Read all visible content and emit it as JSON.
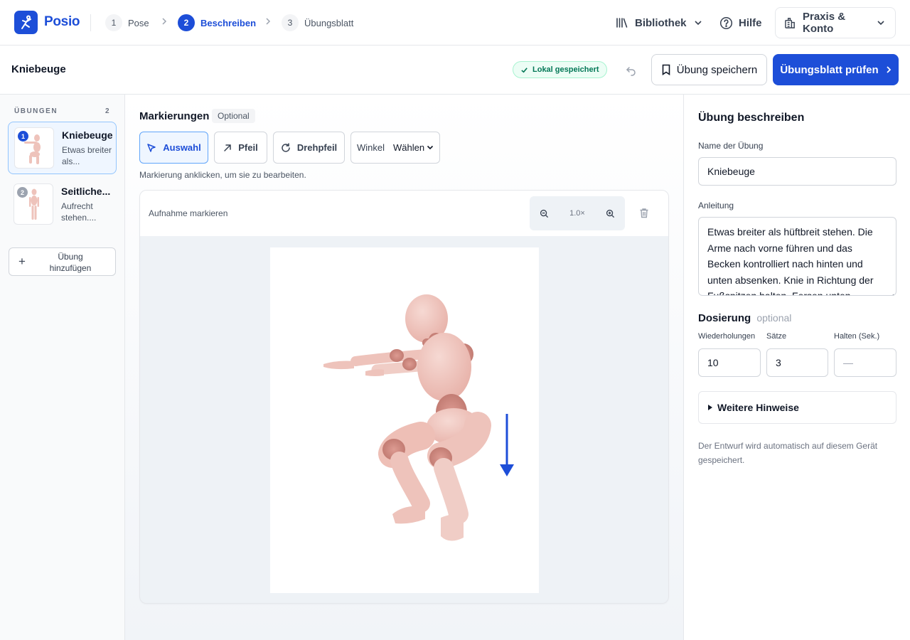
{
  "app": {
    "brand": "Posio",
    "colors": {
      "accent": "#1d4ed8",
      "success": "#047857",
      "figure": "#eec3bb"
    }
  },
  "steps": [
    {
      "num": "1",
      "label": "Pose",
      "state": "done"
    },
    {
      "num": "2",
      "label": "Beschreiben",
      "state": "active"
    },
    {
      "num": "3",
      "label": "Übungsblatt",
      "state": "todo"
    }
  ],
  "topnav": {
    "library_label": "Bibliothek",
    "library_icon": "library-icon",
    "help_label": "Hilfe",
    "help_icon": "question-circle-icon",
    "account_label": "Praxis & Konto",
    "account_icon": "building-icon"
  },
  "header": {
    "page_title": "Kniebeuge",
    "saved_badge": "Lokal gespeichert",
    "save_button": "Übung speichern",
    "primary_button": "Übungsblatt prüfen"
  },
  "sidebar": {
    "heading": "ÜBUNGEN",
    "count": "2",
    "exercises": [
      {
        "index": "1",
        "title": "Kniebeuge",
        "desc": "Etwas breiter als...",
        "active": true
      },
      {
        "index": "2",
        "title": "Seitliche...",
        "desc": "Aufrecht stehen....",
        "active": false
      }
    ],
    "add_button": "Übung hinzufügen"
  },
  "markup": {
    "title": "Markierungen",
    "optional_tag": "Optional",
    "tools": [
      {
        "label": "Auswahl",
        "icon": "cursor-icon",
        "active": true
      },
      {
        "label": "Pfeil",
        "icon": "arrow-up-right-icon",
        "active": false
      },
      {
        "label": "Drehpfeil",
        "icon": "rotate-icon",
        "active": false
      }
    ],
    "angle_label": "Winkel",
    "angle_select": "Wählen",
    "hint": "Markierung anklicken, um sie zu bearbeiten.",
    "canvas_label": "Aufnahme markieren",
    "zoom_level": "1.0×"
  },
  "form": {
    "title": "Übung beschreiben",
    "name_label": "Name der Übung",
    "name_value": "Kniebeuge",
    "instructions_label": "Anleitung",
    "instructions_value": "Etwas breiter als hüftbreit stehen. Die Arme nach vorne führen und das Becken kontrolliert nach hinten und unten absenken. Knie in Richtung der Fußspitzen halten. Fersen unten",
    "dosage_title": "Dosierung",
    "dosage_optional": "optional",
    "reps_label": "Wiederholungen",
    "reps_value": "10",
    "sets_label": "Sätze",
    "sets_value": "3",
    "hold_label": "Halten (Sek.)",
    "hold_placeholder": "—",
    "details_label": "Weitere Hinweise",
    "footnote": "Der Entwurf wird automatisch auf diesem Gerät gespeichert."
  }
}
